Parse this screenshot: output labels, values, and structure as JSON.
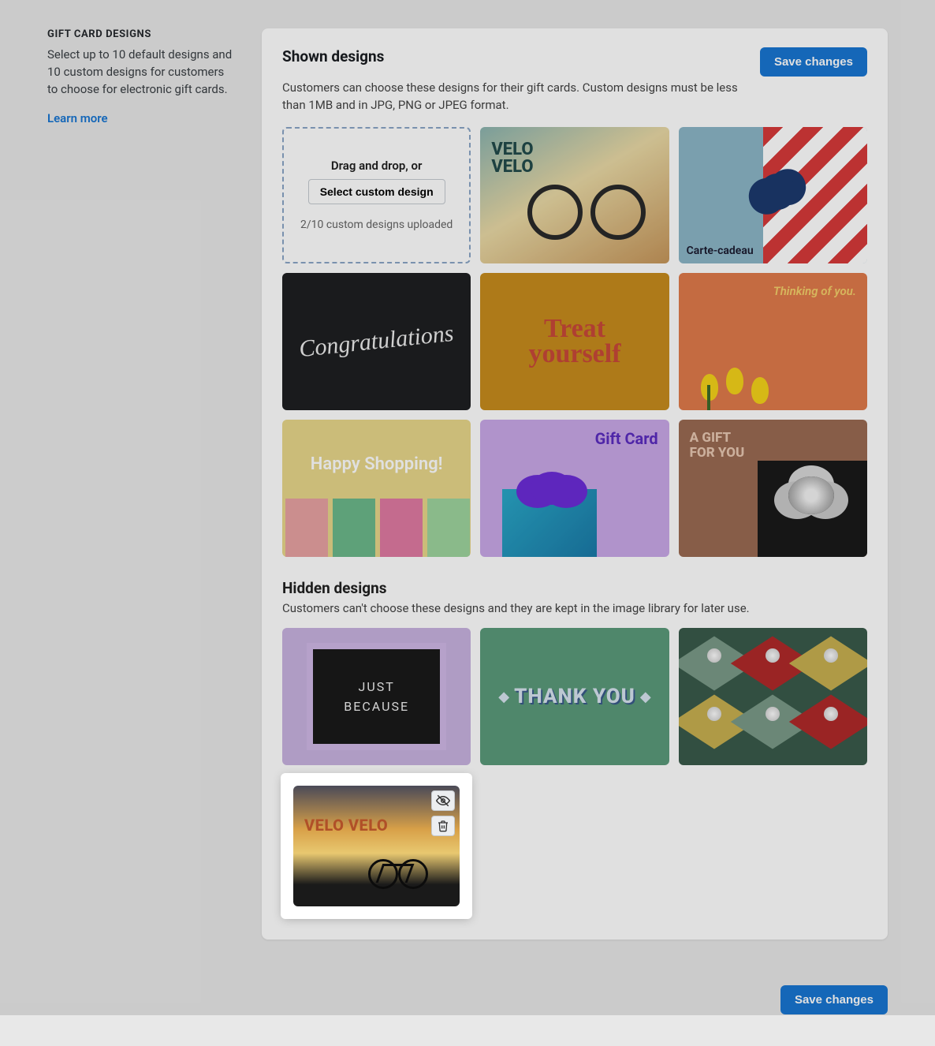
{
  "sidebar": {
    "title": "Gift Card Designs",
    "description": "Select up to 10 default designs and 10 custom designs for customers to choose for electronic gift cards.",
    "learn_more": "Learn more"
  },
  "shown": {
    "heading": "Shown designs",
    "description": "Customers can choose these designs for their gift cards. Custom designs must be less than 1MB and in JPG, PNG or JPEG format.",
    "save_button": "Save changes",
    "upload": {
      "drag_label": "Drag and drop, or",
      "select_button": "Select custom design",
      "count_label": "2/10 custom designs uploaded"
    },
    "cards": [
      {
        "id": "velo-velo",
        "text": "VELO\nVELO"
      },
      {
        "id": "carte-cadeau",
        "text": "Carte-cadeau"
      },
      {
        "id": "congratulations",
        "text": "Congratulations"
      },
      {
        "id": "treat-yourself",
        "text": "Treat yourself"
      },
      {
        "id": "thinking-of-you",
        "text": "Thinking of you."
      },
      {
        "id": "happy-shopping",
        "text": "Happy Shopping!"
      },
      {
        "id": "gift-card",
        "text": "Gift Card"
      },
      {
        "id": "a-gift-for-you",
        "text": "A GIFT FOR YOU"
      }
    ]
  },
  "hidden": {
    "heading": "Hidden designs",
    "description": "Customers can't choose these designs and they are kept in the image library for later use.",
    "cards": [
      {
        "id": "just-because",
        "text": "JUST BECAUSE"
      },
      {
        "id": "thank-you",
        "text": "THANK YOU"
      },
      {
        "id": "gift-boxes",
        "text": ""
      },
      {
        "id": "velo-velo-sunset",
        "text": "VELO VELO",
        "selected": true
      }
    ]
  },
  "footer": {
    "save_button": "Save changes"
  }
}
